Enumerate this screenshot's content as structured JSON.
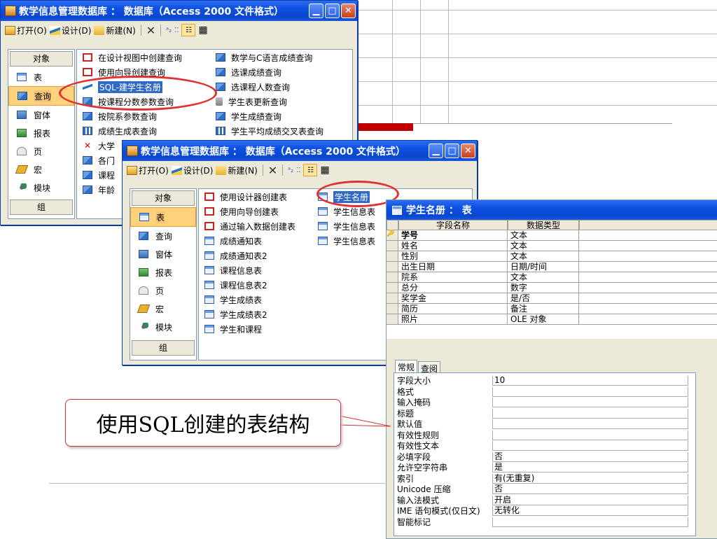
{
  "window_back": {
    "title": "教学信息管理数据库 ： 数据库（Access 2000 文件格式）",
    "toolbar": {
      "open_label": "打开(O)",
      "design_label": "设计(D)",
      "new_label": "新建(N)"
    },
    "objects_header": "对象",
    "objects": [
      {
        "label": "表",
        "icon": "table-icon"
      },
      {
        "label": "查询",
        "icon": "query-icon",
        "selected": true
      },
      {
        "label": "窗体",
        "icon": "form-icon"
      },
      {
        "label": "报表",
        "icon": "report-icon"
      },
      {
        "label": "页",
        "icon": "page-icon"
      },
      {
        "label": "宏",
        "icon": "macro-icon"
      },
      {
        "label": "模块",
        "icon": "module-icon"
      }
    ],
    "groups_label": "组",
    "queries_col1": [
      {
        "label": "在设计视图中创建查询",
        "icon": "design-query-icon"
      },
      {
        "label": "使用向导创建查询",
        "icon": "wizard-query-icon"
      },
      {
        "label": "SQL-建学生名册",
        "icon": "sql-query-icon",
        "selected": true
      },
      {
        "label": "按课程分数参数查询",
        "icon": "query-icon"
      },
      {
        "label": "按院系参数查询",
        "icon": "query-icon"
      },
      {
        "label": "成绩生成表查询",
        "icon": "make-table-query-icon"
      },
      {
        "label": "大学",
        "icon": "delete-query-icon"
      },
      {
        "label": "各门",
        "icon": "query-icon"
      },
      {
        "label": "课程",
        "icon": "query-icon"
      },
      {
        "label": "年龄",
        "icon": "query-icon"
      }
    ],
    "queries_col2": [
      {
        "label": "数学与C语言成绩查询",
        "icon": "query-icon"
      },
      {
        "label": "选课成绩查询",
        "icon": "query-icon"
      },
      {
        "label": "选课程人数查询",
        "icon": "query-icon"
      },
      {
        "label": "学生表更新查询",
        "icon": "update-query-icon"
      },
      {
        "label": "学生成绩查询",
        "icon": "query-icon"
      },
      {
        "label": "学生平均成绩交叉表查询",
        "icon": "crosstab-query-icon"
      }
    ]
  },
  "window_front": {
    "title": "教学信息管理数据库 ： 数据库（Access 2000 文件格式）",
    "toolbar": {
      "open_label": "打开(O)",
      "design_label": "设计(D)",
      "new_label": "新建(N)"
    },
    "objects_header": "对象",
    "objects": [
      {
        "label": "表",
        "icon": "table-icon",
        "selected": true
      },
      {
        "label": "查询",
        "icon": "query-icon"
      },
      {
        "label": "窗体",
        "icon": "form-icon"
      },
      {
        "label": "报表",
        "icon": "report-icon"
      },
      {
        "label": "页",
        "icon": "page-icon"
      },
      {
        "label": "宏",
        "icon": "macro-icon"
      },
      {
        "label": "模块",
        "icon": "module-icon"
      }
    ],
    "groups_label": "组",
    "tables_col1": [
      "使用设计器创建表",
      "使用向导创建表",
      "通过输入数据创建表",
      "成绩通知表",
      "成绩通知表2",
      "课程信息表",
      "课程信息表2",
      "学生成绩表",
      "学生成绩表2",
      "学生和课程"
    ],
    "tables_col2": [
      {
        "label": "学生名册",
        "selected": true
      },
      {
        "label": "学生信息表"
      },
      {
        "label": "学生信息表"
      },
      {
        "label": "学生信息表"
      }
    ]
  },
  "design_window": {
    "title": "学生名册 ： 表",
    "col_field": "字段名称",
    "col_type": "数据类型",
    "fields": [
      {
        "name": "学号",
        "type": "文本",
        "key": true
      },
      {
        "name": "姓名",
        "type": "文本"
      },
      {
        "name": "性别",
        "type": "文本"
      },
      {
        "name": "出生日期",
        "type": "日期/时间"
      },
      {
        "name": "院系",
        "type": "文本"
      },
      {
        "name": "总分",
        "type": "数字"
      },
      {
        "name": "奖学金",
        "type": "是/否"
      },
      {
        "name": "简历",
        "type": "备注"
      },
      {
        "name": "照片",
        "type": "OLE 对象"
      }
    ],
    "tabs": [
      "常规",
      "查阅"
    ],
    "properties": [
      {
        "label": "字段大小",
        "value": "10"
      },
      {
        "label": "格式",
        "value": ""
      },
      {
        "label": "输入掩码",
        "value": ""
      },
      {
        "label": "标题",
        "value": ""
      },
      {
        "label": "默认值",
        "value": ""
      },
      {
        "label": "有效性规则",
        "value": ""
      },
      {
        "label": "有效性文本",
        "value": ""
      },
      {
        "label": "必填字段",
        "value": "否"
      },
      {
        "label": "允许空字符串",
        "value": "是"
      },
      {
        "label": "索引",
        "value": "有(无重复)"
      },
      {
        "label": "Unicode 压缩",
        "value": "否"
      },
      {
        "label": "输入法模式",
        "value": "开启"
      },
      {
        "label": "IME 语句模式(仅日文)",
        "value": "无转化"
      },
      {
        "label": "智能标记",
        "value": ""
      }
    ]
  },
  "callout": {
    "text": "使用SQL创建的表结构"
  },
  "colors": {
    "titlebar": "#0c4fe0",
    "highlight": "#316ac5",
    "ellipse": "#e03030",
    "accent_bar": "#c00000"
  }
}
